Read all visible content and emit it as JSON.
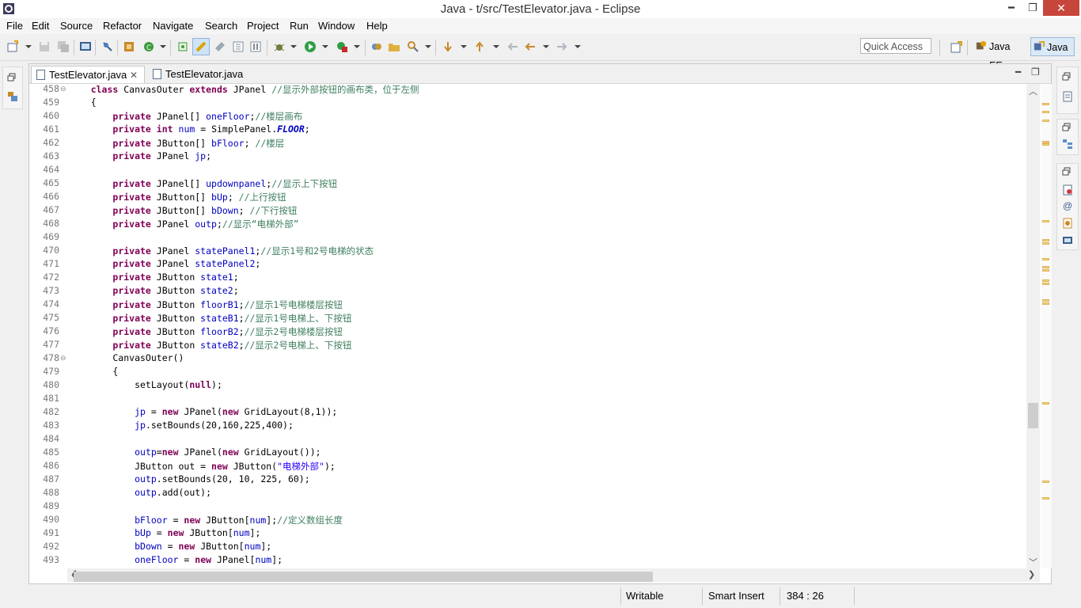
{
  "window": {
    "title": "Java - t/src/TestElevator.java - Eclipse",
    "min_glyph": "━",
    "max_glyph": "❐",
    "close_glyph": "✕"
  },
  "menu": [
    "File",
    "Edit",
    "Source",
    "Refactor",
    "Navigate",
    "Search",
    "Project",
    "Run",
    "Window",
    "Help"
  ],
  "toolbar": {
    "quick_access": "Quick Access",
    "perspectives": [
      "Java EE",
      "Java"
    ]
  },
  "editor": {
    "tabs": [
      {
        "label": "TestElevator.java",
        "close": "✕",
        "active": true
      },
      {
        "label": "TestElevator.java",
        "active": false
      }
    ],
    "minimize_glyph": "━",
    "maximize_glyph": "❐",
    "scroll_left": "❮",
    "scroll_right": "❯",
    "scroll_up": "︿",
    "scroll_down": "﹀",
    "line_numbers": [
      "458",
      "459",
      "460",
      "461",
      "462",
      "463",
      "464",
      "465",
      "466",
      "467",
      "468",
      "469",
      "470",
      "471",
      "472",
      "473",
      "474",
      "475",
      "476",
      "477",
      "478",
      "479",
      "480",
      "481",
      "482",
      "483",
      "484",
      "485",
      "486",
      "487",
      "488",
      "489",
      "490",
      "491",
      "492",
      "493"
    ],
    "code_lines": [
      [
        [
          "    ",
          ""
        ],
        [
          "class",
          "kw"
        ],
        [
          " CanvasOuter ",
          ""
        ],
        [
          "extends",
          "kw"
        ],
        [
          " JPanel ",
          ""
        ],
        [
          "//显示外部按钮的画布类，位于左侧",
          "cm"
        ]
      ],
      [
        [
          "    {",
          ""
        ]
      ],
      [
        [
          "        ",
          ""
        ],
        [
          "private",
          "kw"
        ],
        [
          " JPanel[] ",
          ""
        ],
        [
          "oneFloor",
          "fld"
        ],
        [
          ";",
          ""
        ],
        [
          "//楼层画布",
          "cm"
        ]
      ],
      [
        [
          "        ",
          ""
        ],
        [
          "private",
          "kw"
        ],
        [
          " ",
          ""
        ],
        [
          "int",
          "kw"
        ],
        [
          " ",
          ""
        ],
        [
          "num",
          "fld"
        ],
        [
          " = SimplePanel.",
          ""
        ],
        [
          "FLOOR",
          "sf"
        ],
        [
          ";",
          ""
        ]
      ],
      [
        [
          "        ",
          ""
        ],
        [
          "private",
          "kw"
        ],
        [
          " JButton[] ",
          ""
        ],
        [
          "bFloor",
          "fld"
        ],
        [
          "; ",
          ""
        ],
        [
          "//楼层",
          "cm"
        ]
      ],
      [
        [
          "        ",
          ""
        ],
        [
          "private",
          "kw"
        ],
        [
          " JPanel ",
          ""
        ],
        [
          "jp",
          "fld"
        ],
        [
          ";",
          ""
        ]
      ],
      [
        [
          "",
          ""
        ]
      ],
      [
        [
          "        ",
          ""
        ],
        [
          "private",
          "kw"
        ],
        [
          " JPanel[] ",
          ""
        ],
        [
          "updownpanel",
          "fld"
        ],
        [
          ";",
          ""
        ],
        [
          "//显示上下按钮",
          "cm"
        ]
      ],
      [
        [
          "        ",
          ""
        ],
        [
          "private",
          "kw"
        ],
        [
          " JButton[] ",
          ""
        ],
        [
          "bUp",
          "fld"
        ],
        [
          "; ",
          ""
        ],
        [
          "//上行按钮",
          "cm"
        ]
      ],
      [
        [
          "        ",
          ""
        ],
        [
          "private",
          "kw"
        ],
        [
          " JButton[] ",
          ""
        ],
        [
          "bDown",
          "fld"
        ],
        [
          "; ",
          ""
        ],
        [
          "//下行按钮",
          "cm"
        ]
      ],
      [
        [
          "        ",
          ""
        ],
        [
          "private",
          "kw"
        ],
        [
          " JPanel ",
          ""
        ],
        [
          "outp",
          "fld"
        ],
        [
          ";",
          ""
        ],
        [
          "//显示“电梯外部”",
          "cm"
        ]
      ],
      [
        [
          "",
          ""
        ]
      ],
      [
        [
          "        ",
          ""
        ],
        [
          "private",
          "kw"
        ],
        [
          " JPanel ",
          ""
        ],
        [
          "statePanel1",
          "fld"
        ],
        [
          ";",
          ""
        ],
        [
          "//显示1号和2号电梯的状态",
          "cm"
        ]
      ],
      [
        [
          "        ",
          ""
        ],
        [
          "private",
          "kw"
        ],
        [
          " JPanel ",
          ""
        ],
        [
          "statePanel2",
          "fld"
        ],
        [
          ";",
          ""
        ]
      ],
      [
        [
          "        ",
          ""
        ],
        [
          "private",
          "kw"
        ],
        [
          " JButton ",
          ""
        ],
        [
          "state1",
          "fld"
        ],
        [
          ";",
          ""
        ]
      ],
      [
        [
          "        ",
          ""
        ],
        [
          "private",
          "kw"
        ],
        [
          " JButton ",
          ""
        ],
        [
          "state2",
          "fld"
        ],
        [
          ";",
          ""
        ]
      ],
      [
        [
          "        ",
          ""
        ],
        [
          "private",
          "kw"
        ],
        [
          " JButton ",
          ""
        ],
        [
          "floorB1",
          "fld"
        ],
        [
          ";",
          ""
        ],
        [
          "//显示1号电梯楼层按钮",
          "cm"
        ]
      ],
      [
        [
          "        ",
          ""
        ],
        [
          "private",
          "kw"
        ],
        [
          " JButton ",
          ""
        ],
        [
          "stateB1",
          "fld"
        ],
        [
          ";",
          ""
        ],
        [
          "//显示1号电梯上、下按钮",
          "cm"
        ]
      ],
      [
        [
          "        ",
          ""
        ],
        [
          "private",
          "kw"
        ],
        [
          " JButton ",
          ""
        ],
        [
          "floorB2",
          "fld"
        ],
        [
          ";",
          ""
        ],
        [
          "//显示2号电梯楼层按钮",
          "cm"
        ]
      ],
      [
        [
          "        ",
          ""
        ],
        [
          "private",
          "kw"
        ],
        [
          " JButton ",
          ""
        ],
        [
          "stateB2",
          "fld"
        ],
        [
          ";",
          ""
        ],
        [
          "//显示2号电梯上、下按钮",
          "cm"
        ]
      ],
      [
        [
          "        CanvasOuter()",
          ""
        ]
      ],
      [
        [
          "        {",
          ""
        ]
      ],
      [
        [
          "            setLayout(",
          ""
        ],
        [
          "null",
          "kw"
        ],
        [
          ");",
          ""
        ]
      ],
      [
        [
          "",
          ""
        ]
      ],
      [
        [
          "            ",
          ""
        ],
        [
          "jp",
          "fld"
        ],
        [
          " = ",
          ""
        ],
        [
          "new",
          "kw"
        ],
        [
          " JPanel(",
          ""
        ],
        [
          "new",
          "kw"
        ],
        [
          " GridLayout(8,1));",
          ""
        ]
      ],
      [
        [
          "            ",
          ""
        ],
        [
          "jp",
          "fld"
        ],
        [
          ".setBounds(20,160,225,400);",
          ""
        ]
      ],
      [
        [
          "",
          ""
        ]
      ],
      [
        [
          "            ",
          ""
        ],
        [
          "outp",
          "fld"
        ],
        [
          "=",
          ""
        ],
        [
          "new",
          "kw"
        ],
        [
          " JPanel(",
          ""
        ],
        [
          "new",
          "kw"
        ],
        [
          " GridLayout());",
          ""
        ]
      ],
      [
        [
          "            JButton out = ",
          ""
        ],
        [
          "new",
          "kw"
        ],
        [
          " JButton(",
          ""
        ],
        [
          "\"电梯外部\"",
          "str"
        ],
        [
          ");",
          ""
        ]
      ],
      [
        [
          "            ",
          ""
        ],
        [
          "outp",
          "fld"
        ],
        [
          ".setBounds(20, 10, 225, 60);",
          ""
        ]
      ],
      [
        [
          "            ",
          ""
        ],
        [
          "outp",
          "fld"
        ],
        [
          ".add(out);",
          ""
        ]
      ],
      [
        [
          "",
          ""
        ]
      ],
      [
        [
          "            ",
          ""
        ],
        [
          "bFloor",
          "fld"
        ],
        [
          " = ",
          ""
        ],
        [
          "new",
          "kw"
        ],
        [
          " JButton[",
          ""
        ],
        [
          "num",
          "fld"
        ],
        [
          "];",
          ""
        ],
        [
          "//定义数组长度",
          "cm"
        ]
      ],
      [
        [
          "            ",
          ""
        ],
        [
          "bUp",
          "fld"
        ],
        [
          " = ",
          ""
        ],
        [
          "new",
          "kw"
        ],
        [
          " JButton[",
          ""
        ],
        [
          "num",
          "fld"
        ],
        [
          "];",
          ""
        ]
      ],
      [
        [
          "            ",
          ""
        ],
        [
          "bDown",
          "fld"
        ],
        [
          " = ",
          ""
        ],
        [
          "new",
          "kw"
        ],
        [
          " JButton[",
          ""
        ],
        [
          "num",
          "fld"
        ],
        [
          "];",
          ""
        ]
      ],
      [
        [
          "            ",
          ""
        ],
        [
          "oneFloor",
          "fld"
        ],
        [
          " = ",
          ""
        ],
        [
          "new",
          "kw"
        ],
        [
          " JPanel[",
          ""
        ],
        [
          "num",
          "fld"
        ],
        [
          "];",
          ""
        ]
      ]
    ]
  },
  "status": {
    "mode": "Writable",
    "insert": "Smart Insert",
    "position": "384 : 26"
  }
}
